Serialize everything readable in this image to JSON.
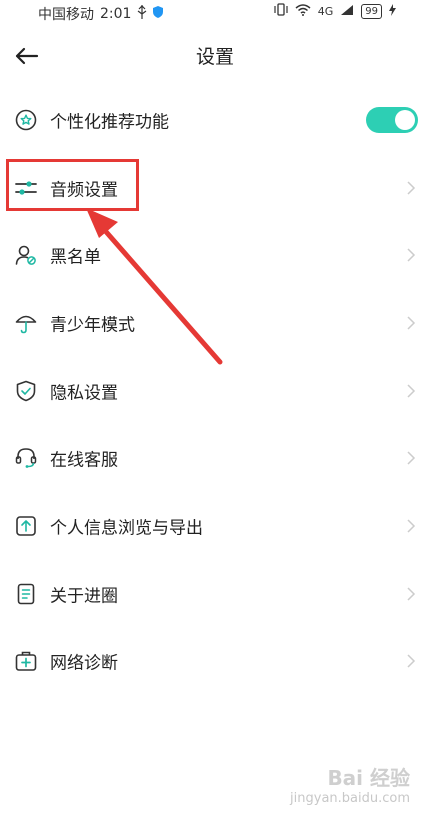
{
  "status_bar": {
    "carrier": "中国移动",
    "time": "2:01",
    "network": "4G",
    "battery": "99"
  },
  "header": {
    "title": "设置"
  },
  "menu": {
    "items": [
      {
        "label": "个性化推荐功能",
        "icon": "star-circle-icon",
        "control": "toggle",
        "toggle_on": true
      },
      {
        "label": "音频设置",
        "icon": "sliders-icon",
        "control": "chevron"
      },
      {
        "label": "黑名单",
        "icon": "user-blocked-icon",
        "control": "chevron"
      },
      {
        "label": "青少年模式",
        "icon": "umbrella-icon",
        "control": "chevron"
      },
      {
        "label": "隐私设置",
        "icon": "shield-check-icon",
        "control": "chevron"
      },
      {
        "label": "在线客服",
        "icon": "headset-icon",
        "control": "chevron"
      },
      {
        "label": "个人信息浏览与导出",
        "icon": "upload-icon",
        "control": "chevron"
      },
      {
        "label": "关于进圈",
        "icon": "document-icon",
        "control": "chevron"
      },
      {
        "label": "网络诊断",
        "icon": "medkit-icon",
        "control": "chevron"
      }
    ]
  },
  "colors": {
    "accent": "#2dcfb4",
    "icon_teal": "#1fb8a3",
    "icon_dark": "#333333",
    "chevron": "#cccccc",
    "annotation_red": "#e53935"
  },
  "watermark": {
    "main": "Bai 经验",
    "sub": "jingyan.baidu.com"
  }
}
